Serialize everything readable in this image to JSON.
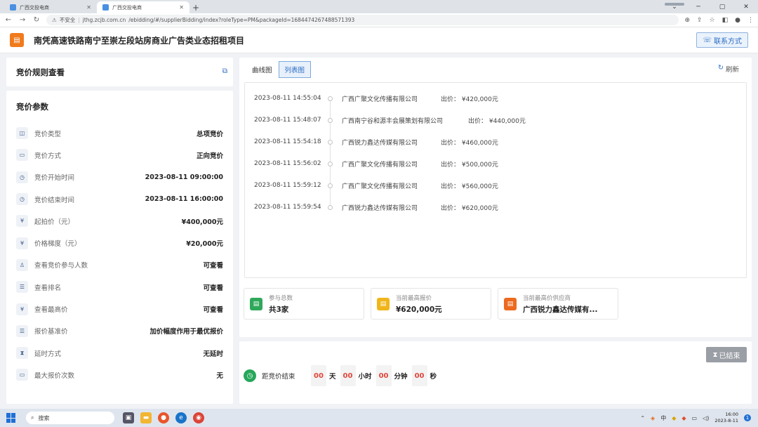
{
  "browser": {
    "tabs": [
      {
        "title": "广西交投电商"
      },
      {
        "title": "广西交投电商"
      }
    ],
    "new_tab": "+",
    "window_controls": [
      "⌄",
      "─",
      "▢",
      "✕"
    ],
    "security_label": "不安全",
    "url_domain": "jthg.zcjb.com.cn",
    "url_path": "/ebidding/#/supplierBidding/index?roleType=PM&packageId=1684474267488571393"
  },
  "header": {
    "title": "南凭高速铁路南宁至崇左段站房商业广告类业态招租项目",
    "contact_label": "联系方式"
  },
  "rules_panel": {
    "title": "竞价规则查看"
  },
  "params_panel": {
    "title": "竞价参数",
    "rows": [
      {
        "icon": "tag-icon",
        "glyph": "◫",
        "label": "竞价类型",
        "value": "总项竞价"
      },
      {
        "icon": "direction-icon",
        "glyph": "▭",
        "label": "竞价方式",
        "value": "正向竞价"
      },
      {
        "icon": "clock-icon",
        "glyph": "◷",
        "label": "竞价开始时间",
        "value": "2023-08-11 09:00:00"
      },
      {
        "icon": "clock-icon",
        "glyph": "◷",
        "label": "竞价结束时间",
        "value": "2023-08-11 16:00:00"
      },
      {
        "icon": "yen-icon",
        "glyph": "¥",
        "label": "起拍价（元）",
        "value": "¥400,000元"
      },
      {
        "icon": "yen-icon",
        "glyph": "¥",
        "label": "价格梯度（元）",
        "value": "¥20,000元"
      },
      {
        "icon": "user-icon",
        "glyph": "♙",
        "label": "查看竞价参与人数",
        "value": "可查看"
      },
      {
        "icon": "list-icon",
        "glyph": "☰",
        "label": "查看排名",
        "value": "可查看"
      },
      {
        "icon": "yen-icon",
        "glyph": "¥",
        "label": "查看最高价",
        "value": "可查看"
      },
      {
        "icon": "list-icon",
        "glyph": "☰",
        "label": "报价基准价",
        "value": "加价幅度作用于最优报价"
      },
      {
        "icon": "hourglass-icon",
        "glyph": "⧗",
        "label": "延时方式",
        "value": "无延时"
      },
      {
        "icon": "counter-icon",
        "glyph": "▭",
        "label": "最大报价次数",
        "value": "无"
      }
    ]
  },
  "chart_panel": {
    "tabs": [
      {
        "label": "曲线图",
        "active": false
      },
      {
        "label": "列表图",
        "active": true
      }
    ],
    "refresh_label": "刷新",
    "bid_label": "出价：",
    "bids": [
      {
        "time": "2023-08-11 14:55:04",
        "company": "广西广聚文化传播有限公司",
        "amount": "¥420,000元"
      },
      {
        "time": "2023-08-11 15:48:07",
        "company": "广西南宁谷和源丰会展策划有限公司",
        "amount": "¥440,000元"
      },
      {
        "time": "2023-08-11 15:54:18",
        "company": "广西锐力鑫达传媒有限公司",
        "amount": "¥460,000元"
      },
      {
        "time": "2023-08-11 15:56:02",
        "company": "广西广聚文化传播有限公司",
        "amount": "¥500,000元"
      },
      {
        "time": "2023-08-11 15:59:12",
        "company": "广西广聚文化传播有限公司",
        "amount": "¥560,000元"
      },
      {
        "time": "2023-08-11 15:59:54",
        "company": "广西锐力鑫达传媒有限公司",
        "amount": "¥620,000元"
      }
    ],
    "stats": [
      {
        "label": "参与总数",
        "value": "共3家",
        "color": "#2fa85b"
      },
      {
        "label": "当前最高报价",
        "value": "¥620,000元",
        "color": "#f0b51a"
      },
      {
        "label": "当前最高价供应商",
        "value": "广西锐力鑫达传媒有...",
        "color": "#ec6a1f"
      }
    ]
  },
  "countdown": {
    "ended_label": "已结束",
    "label": "距竞价结束",
    "days": "00",
    "days_unit": "天",
    "hours": "00",
    "hours_unit": "小时",
    "minutes": "00",
    "minutes_unit": "分钟",
    "seconds": "00",
    "seconds_unit": "秒"
  },
  "taskbar": {
    "search_label": "搜索",
    "tray_ime": "中",
    "time": "16:00",
    "date": "2023-8-11",
    "notification_count": "1"
  }
}
